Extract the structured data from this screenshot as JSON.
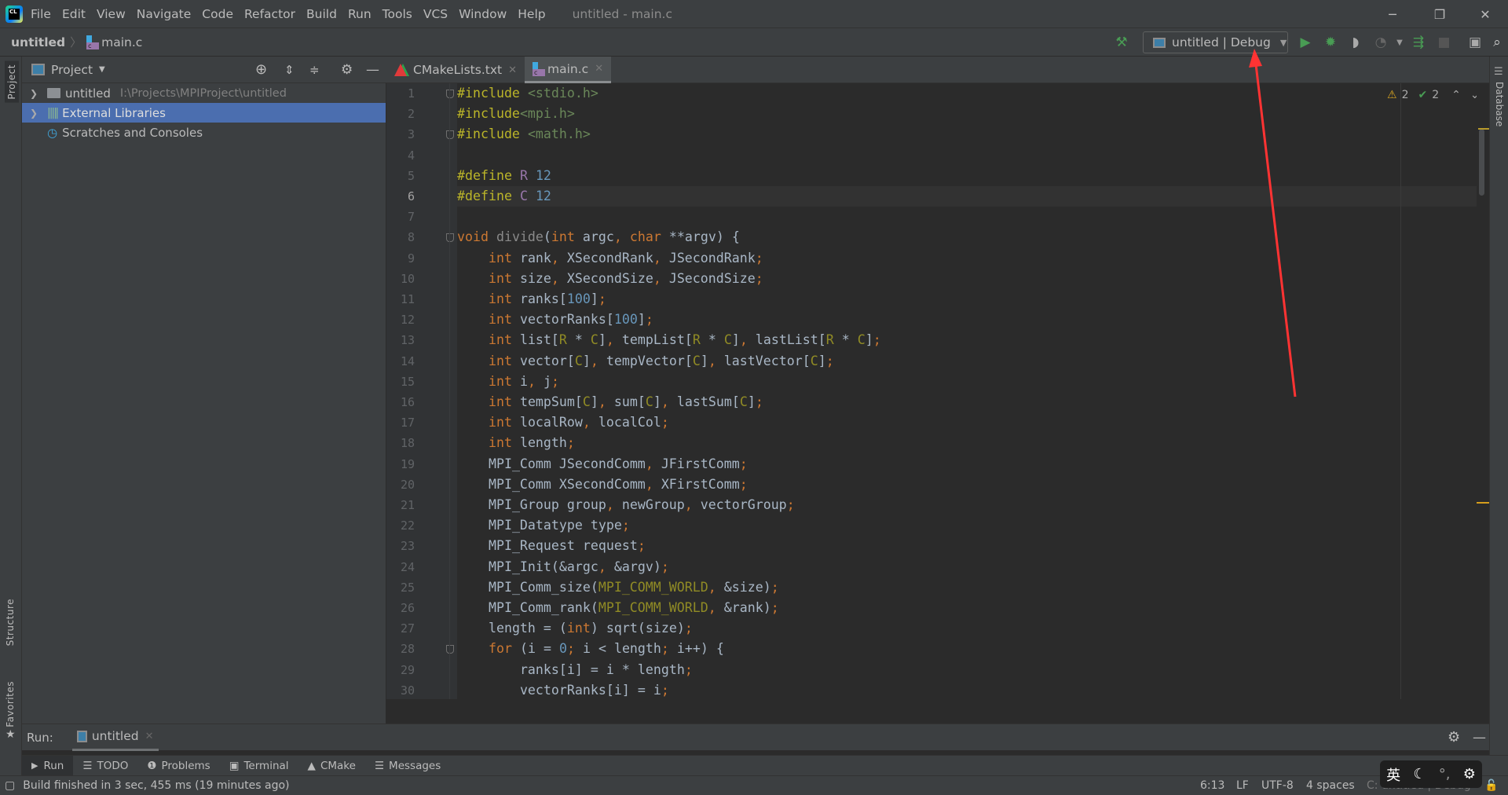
{
  "app": {
    "logo_text": "CL",
    "window_title": "untitled - main.c"
  },
  "menu": [
    "File",
    "Edit",
    "View",
    "Navigate",
    "Code",
    "Refactor",
    "Build",
    "Run",
    "Tools",
    "VCS",
    "Window",
    "Help"
  ],
  "breadcrumb": {
    "project": "untitled",
    "file": "main.c"
  },
  "toolbar": {
    "run_config": "untitled | Debug"
  },
  "project_panel": {
    "title": "Project",
    "tree": [
      {
        "label": "untitled",
        "path": "I:\\Projects\\MPIProject\\untitled"
      },
      {
        "label": "External Libraries",
        "selected": true
      },
      {
        "label": "Scratches and Consoles"
      }
    ]
  },
  "left_strip": {
    "project": "Project",
    "structure": "Structure",
    "favorites": "Favorites"
  },
  "right_strip": {
    "database": "Database"
  },
  "editor": {
    "tabs": [
      {
        "label": "CMakeLists.txt",
        "active": false
      },
      {
        "label": "main.c",
        "active": true
      }
    ],
    "current_line": 6,
    "inspections": {
      "warnings": "2",
      "typos": "2"
    },
    "lines": [
      "#include <stdio.h>",
      "#include<mpi.h>",
      "#include <math.h>",
      "",
      "#define R 12",
      "#define C 12",
      "",
      "void divide(int argc, char **argv) {",
      "    int rank, XSecondRank, JSecondRank;",
      "    int size, XSecondSize, JSecondSize;",
      "    int ranks[100];",
      "    int vectorRanks[100];",
      "    int list[R * C], tempList[R * C], lastList[R * C];",
      "    int vector[C], tempVector[C], lastVector[C];",
      "    int i, j;",
      "    int tempSum[C], sum[C], lastSum[C];",
      "    int localRow, localCol;",
      "    int length;",
      "    MPI_Comm JSecondComm, JFirstComm;",
      "    MPI_Comm XSecondComm, XFirstComm;",
      "    MPI_Group group, newGroup, vectorGroup;",
      "    MPI_Datatype type;",
      "    MPI_Request request;",
      "    MPI_Init(&argc, &argv);",
      "    MPI_Comm_size(MPI_COMM_WORLD, &size);",
      "    MPI_Comm_rank(MPI_COMM_WORLD, &rank);",
      "    length = (int) sqrt(size);",
      "    for (i = 0; i < length; i++) {",
      "        ranks[i] = i * length;",
      "        vectorRanks[i] = i;"
    ]
  },
  "run_bar": {
    "label": "Run:",
    "tab": "untitled"
  },
  "tool_tabs": [
    "Run",
    "TODO",
    "Problems",
    "Terminal",
    "CMake",
    "Messages"
  ],
  "status": {
    "message": "Build finished in 3 sec, 455 ms (19 minutes ago)",
    "position": "6:13",
    "line_sep": "LF",
    "encoding": "UTF-8",
    "indent": "4 spaces",
    "context": "C: untitled | Debug"
  },
  "ime": {
    "lang": "英"
  },
  "colors": {
    "keyword": "#cc7832",
    "preprocessor": "#bbb529",
    "string": "#6a8759",
    "number": "#6897bb",
    "macro": "#908b25",
    "selection": "#4b6eaf",
    "annotation_arrow": "#ff3333"
  }
}
